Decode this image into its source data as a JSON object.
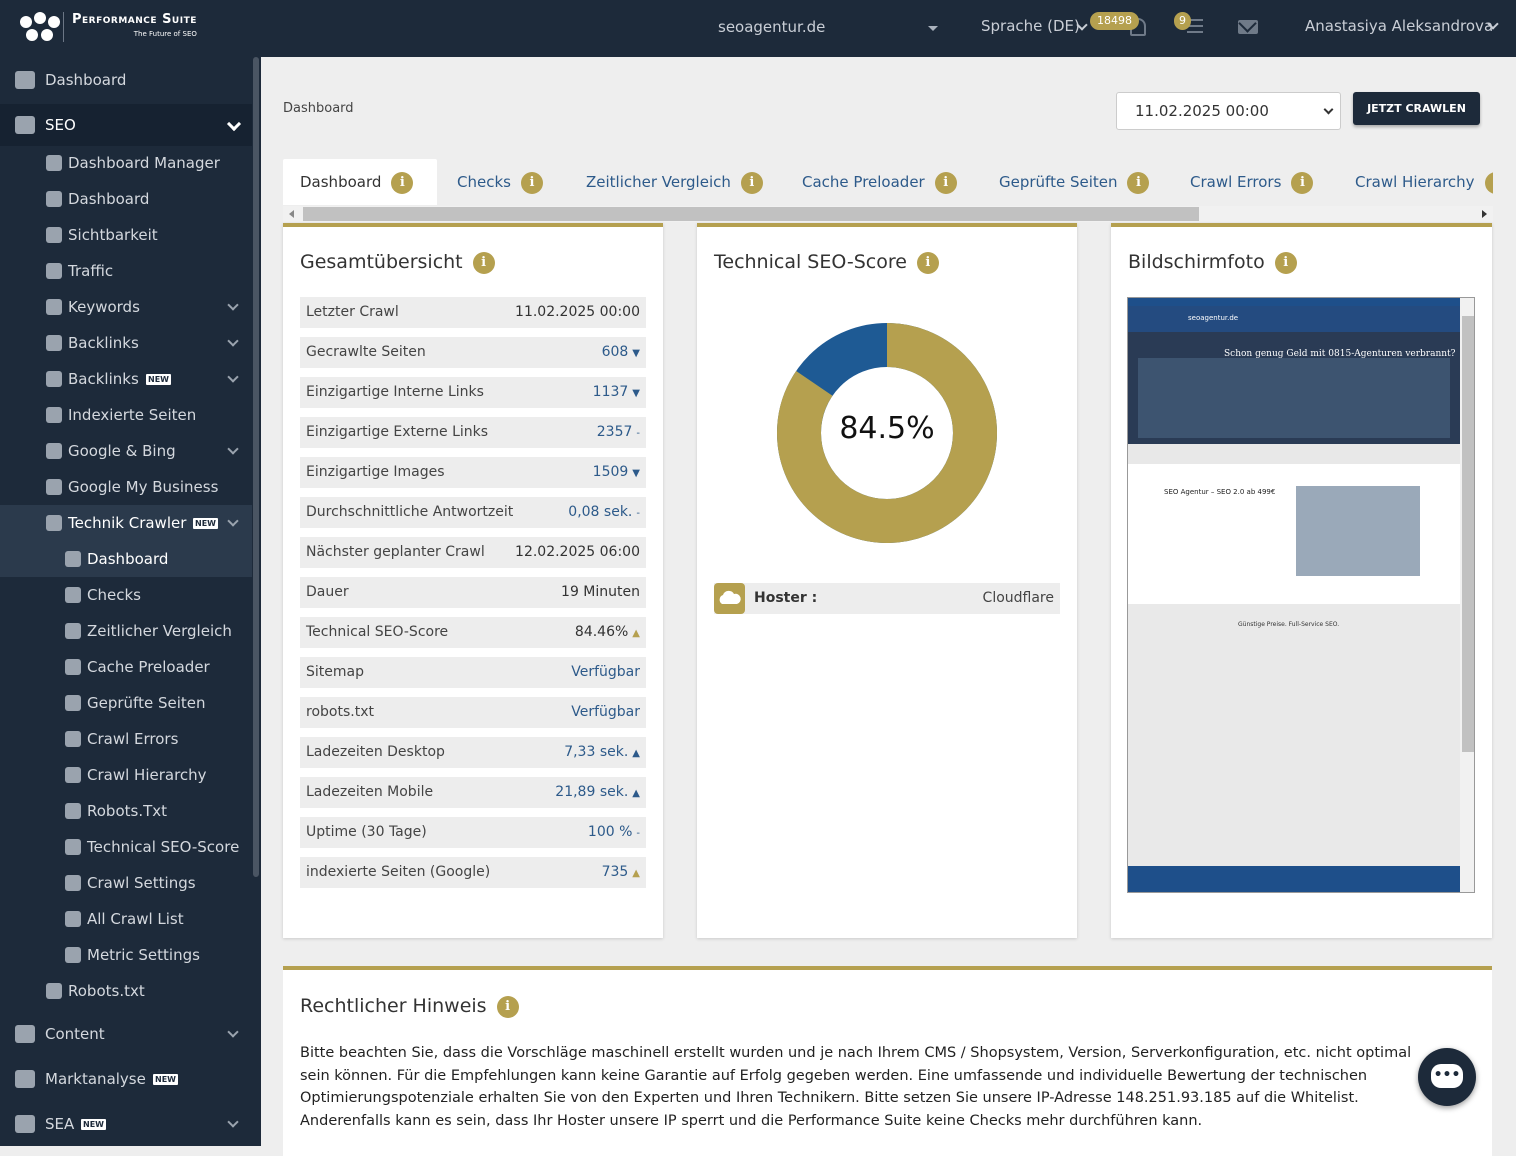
{
  "header": {
    "brand": "Performance Suite",
    "tagline": "The Future of SEO",
    "domain": "seoagentur.de",
    "language": "Sprache (DE)",
    "notification_count": "18498",
    "task_count": "9",
    "user_name": "Anastasiya Aleksandrova"
  },
  "sidebar": {
    "items": [
      {
        "label": "Dashboard",
        "icon": "home-icon"
      },
      {
        "label": "SEO",
        "icon": "google-icon"
      },
      {
        "label": "Dashboard Manager",
        "icon": "palette-icon"
      },
      {
        "label": "Dashboard",
        "icon": "palette-icon"
      },
      {
        "label": "Sichtbarkeit",
        "icon": "eye-icon"
      },
      {
        "label": "Traffic",
        "icon": "gears-icon"
      },
      {
        "label": "Keywords",
        "icon": "key-icon"
      },
      {
        "label": "Backlinks",
        "icon": "external-link-icon"
      },
      {
        "label": "Backlinks",
        "icon": "pie-chart-icon",
        "badge": "NEW"
      },
      {
        "label": "Indexierte Seiten",
        "icon": "file-icon"
      },
      {
        "label": "Google & Bing",
        "icon": "area-chart-icon"
      },
      {
        "label": "Google My Business",
        "icon": "store-icon"
      },
      {
        "label": "Technik Crawler",
        "icon": "pie-chart-icon",
        "badge": "NEW"
      },
      {
        "label": "Dashboard",
        "icon": "gauge-icon"
      },
      {
        "label": "Checks",
        "icon": "checkbox-icon"
      },
      {
        "label": "Zeitlicher Vergleich",
        "icon": "hourglass-icon"
      },
      {
        "label": "Cache Preloader",
        "icon": "refresh-icon"
      },
      {
        "label": "Geprüfte Seiten",
        "icon": "calendar-check-icon"
      },
      {
        "label": "Crawl Errors",
        "icon": "p-circle-icon"
      },
      {
        "label": "Crawl Hierarchy",
        "icon": "p-circle-icon"
      },
      {
        "label": "Robots.Txt",
        "icon": "p-circle-icon"
      },
      {
        "label": "Technical SEO-Score",
        "icon": "p-circle-icon"
      },
      {
        "label": "Crawl Settings",
        "icon": "p-circle-icon"
      },
      {
        "label": "All Crawl List",
        "icon": "p-circle-icon"
      },
      {
        "label": "Metric Settings",
        "icon": "p-circle-icon"
      },
      {
        "label": "Robots.txt",
        "icon": "eye-icon"
      },
      {
        "label": "Content",
        "icon": "circle-icon"
      },
      {
        "label": "Marktanalyse",
        "icon": "users-icon",
        "badge": "NEW"
      },
      {
        "label": "SEA",
        "icon": "pie-chart-icon",
        "badge": "NEW"
      }
    ]
  },
  "main": {
    "breadcrumb": "Dashboard",
    "crawl_date": "11.02.2025 00:00",
    "crawl_button": "JETZT CRAWLEN",
    "tabs": [
      "Dashboard",
      "Checks",
      "Zeitlicher Vergleich",
      "Cache Preloader",
      "Geprüfte Seiten",
      "Crawl Errors",
      "Crawl Hierarchy"
    ],
    "overview": {
      "title": "Gesamtübersicht",
      "rows": [
        {
          "label": "Letzter Crawl",
          "value": "11.02.2025 00:00",
          "trend": ""
        },
        {
          "label": "Gecrawlte Seiten",
          "value": "608",
          "trend": "▼"
        },
        {
          "label": "Einzigartige Interne Links",
          "value": "1137",
          "trend": "▼"
        },
        {
          "label": "Einzigartige Externe Links",
          "value": "2357",
          "trend": "-"
        },
        {
          "label": "Einzigartige Images",
          "value": "1509",
          "trend": "▼"
        },
        {
          "label": "Durchschnittliche Antwortzeit",
          "value": "0,08 sek.",
          "trend": "-"
        },
        {
          "label": "Nächster geplanter Crawl",
          "value": "12.02.2025 06:00",
          "trend": ""
        },
        {
          "label": "Dauer",
          "value": "19 Minuten",
          "trend": ""
        },
        {
          "label": "Technical SEO-Score",
          "value": "84.46%",
          "trend": "▲"
        },
        {
          "label": "Sitemap",
          "value": "Verfügbar",
          "trend": ""
        },
        {
          "label": "robots.txt",
          "value": "Verfügbar",
          "trend": ""
        },
        {
          "label": "Ladezeiten Desktop",
          "value": "7,33 sek.",
          "trend": "▲"
        },
        {
          "label": "Ladezeiten Mobile",
          "value": "21,89 sek.",
          "trend": "▲"
        },
        {
          "label": "Uptime (30 Tage)",
          "value": "100 %",
          "trend": "-"
        },
        {
          "label": "indexierte Seiten (Google)",
          "value": "735",
          "trend": "▲"
        }
      ]
    },
    "score": {
      "title": "Technical SEO-Score",
      "value_label": "84.5%",
      "value": 84.5,
      "hoster_label": "Hoster :",
      "hoster_value": "Cloudflare",
      "colors": {
        "score": "#b5a04f",
        "rest": "#1e5a94"
      }
    },
    "screenshot": {
      "title": "Bildschirmfoto",
      "site_name": "seoagentur.de",
      "hero_text": "Schon genug Geld mit 0815-Agenturen verbrannt?",
      "section_title": "SEO Agentur – SEO 2.0 ab 499€",
      "services_title": "Günstige Preise. Full-Service SEO."
    },
    "legal": {
      "title": "Rechtlicher Hinweis",
      "text": "Bitte beachten Sie, dass die Vorschläge maschinell erstellt wurden und je nach Ihrem CMS / Shopsystem, Version, Serverkonfiguration, etc. nicht optimal sein können. Für die Empfehlungen kann keine Garantie auf Erfolg gegeben werden. Eine umfassende und individuelle Bewertung der technischen Optimierungspotenziale erhalten Sie von den Experten und Ihren Technikern. Bitte setzen Sie unsere IP-Adresse 148.251.93.185 auf die Whitelist. Anderenfalls kann es sein, dass Ihr Hoster unsere IP sperrt und die Performance Suite keine Checks mehr durchführen kann."
    }
  }
}
